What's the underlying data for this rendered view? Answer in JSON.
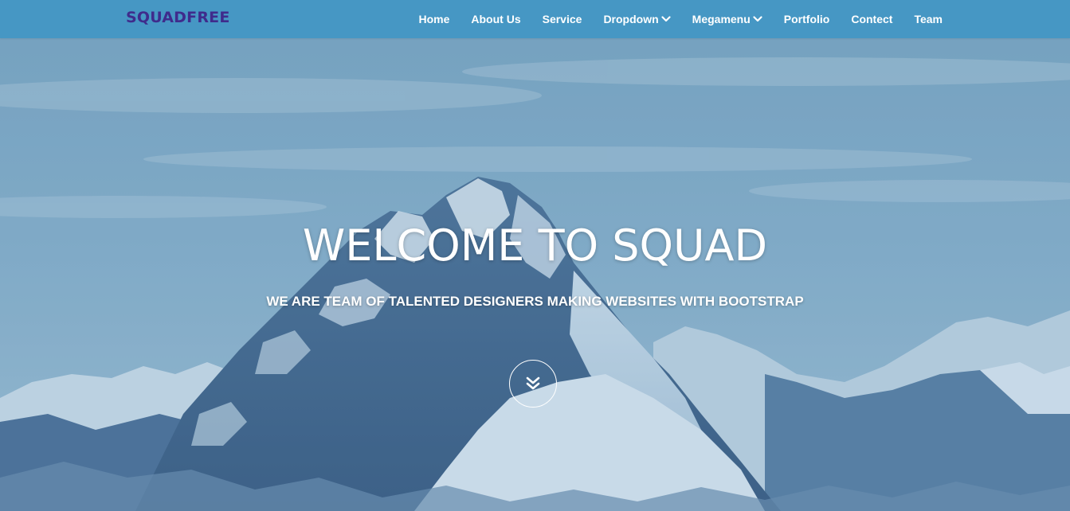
{
  "navbar": {
    "brand": "SQUADFREE",
    "brand_color": "#3f2b8c",
    "background": "#4296c4",
    "items": [
      {
        "label": "Home",
        "dropdown": false
      },
      {
        "label": "About Us",
        "dropdown": false
      },
      {
        "label": "Service",
        "dropdown": false
      },
      {
        "label": "Dropdown",
        "dropdown": true,
        "icon": "chevron-down-icon"
      },
      {
        "label": "Megamenu",
        "dropdown": true,
        "icon": "chevron-down-icon"
      },
      {
        "label": "Portfolio",
        "dropdown": false
      },
      {
        "label": "Contect",
        "dropdown": false
      },
      {
        "label": "Team",
        "dropdown": false
      }
    ]
  },
  "hero": {
    "title": "WELCOME TO SQUAD",
    "subtitle": "WE ARE TEAM OF TALENTED DESIGNERS MAKING WEBSITES WITH BOOTSTRAP",
    "scroll_icon": "double-chevron-down-icon",
    "background_image": "snowy-mountain-peak"
  }
}
